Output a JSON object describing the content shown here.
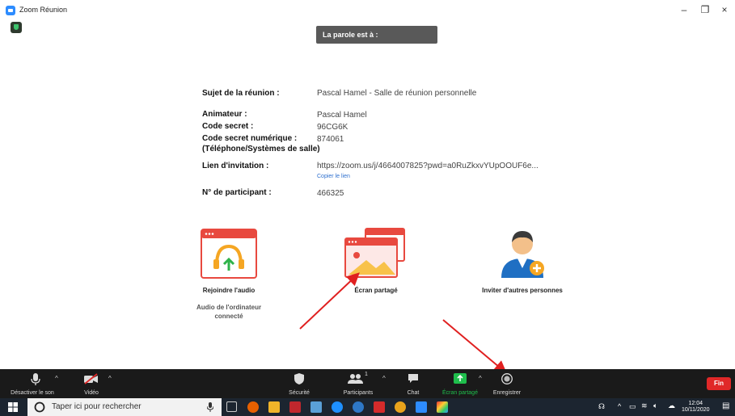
{
  "window": {
    "title": "Zoom Réunion"
  },
  "speaker_banner": "La parole est à :",
  "meeting": {
    "topic_label": "Sujet de la réunion :",
    "topic_value": "Pascal Hamel - Salle de réunion personnelle",
    "host_label": "Animateur :",
    "host_value": "Pascal Hamel",
    "passcode_label": "Code secret :",
    "passcode_value": "96CG6K",
    "numeric_label": "Code secret numérique :",
    "numeric_value": "874061",
    "numeric_sub": "(Téléphone/Systèmes de salle)",
    "invite_label": "Lien d'invitation :",
    "invite_value": "https://zoom.us/j/4664007825?pwd=a0RuZkxvYUpOOUF6e...",
    "copy_link": "Copier le lien",
    "participant_label": "N° de participant :",
    "participant_value": "466325"
  },
  "tiles": {
    "audio": {
      "label": "Rejoindre l'audio",
      "sub1": "Audio de l'ordinateur",
      "sub2": "connecté"
    },
    "share": {
      "label": "Écran partagé"
    },
    "invite": {
      "label": "Inviter d'autres personnes"
    }
  },
  "toolbar": {
    "mute": "Désactiver le son",
    "video": "Vidéo",
    "security": "Sécurité",
    "participants": "Participants",
    "participants_count": "1",
    "chat": "Chat",
    "share": "Écran partagé",
    "record": "Enregistrer",
    "end": "Fin",
    "caret": "^"
  },
  "taskbar": {
    "search_placeholder": "Taper ici pour rechercher",
    "time": "12:04",
    "date": "10/11/2020"
  },
  "colors": {
    "accent": "#2d8cff",
    "end": "#e02828",
    "share_green": "#1fbe4c",
    "annotation_arrow": "#e02020"
  }
}
